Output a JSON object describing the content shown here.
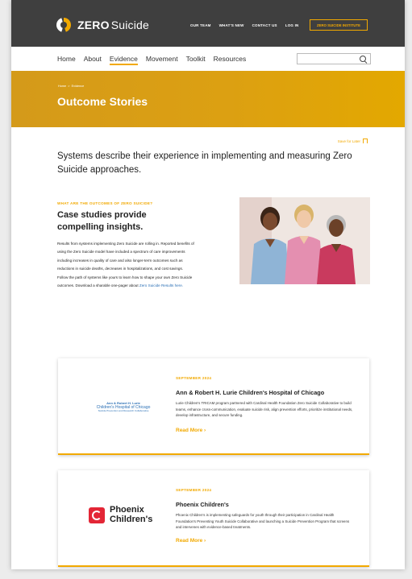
{
  "header": {
    "logo_bold": "ZERO",
    "logo_rest": "Suicide",
    "links": [
      "OUR TEAM",
      "WHAT'S NEW",
      "CONTACT US",
      "LOG IN"
    ],
    "institute_button": "ZERO SUICIDE INSTITUTE"
  },
  "nav": {
    "items": [
      "Home",
      "About",
      "Evidence",
      "Movement",
      "Toolkit",
      "Resources"
    ],
    "active": "Evidence",
    "search_placeholder": ""
  },
  "hero": {
    "breadcrumb": "Home  >  Evidence",
    "title": "Outcome Stories"
  },
  "save_label": "Save for Later",
  "intro": "Systems describe their experience in implementing and measuring Zero Suicide approaches.",
  "case_study": {
    "eyebrow": "WHAT ARE THE OUTCOMES OF ZERO SUICIDE?",
    "title": "Case studies provide compelling insights.",
    "body": "Results from systems implementing Zero Suicide are rolling in. Reported benefits of using the Zero Suicide model have included a spectrum of care improvements including increases in quality of care and also longer-term outcomes such as reductions in suicide deaths, decreases in hospitalizations, and cost savings. Follow the path of systems like yours to learn how to shape your own Zero Suicide outcomes. Download a sharable one-pager about",
    "link": "Zero Suicide Results here."
  },
  "cards": [
    {
      "date": "SEPTEMBER 2024",
      "title": "Ann & Robert H. Lurie Children's Hospital of Chicago",
      "text": "Lurie Children's TRICAM program partnered with Cardinal Health Foundation Zero Suicide Collaborative to build teams, enhance cross-communication, evaluate suicide risk, align prevention efforts, prioritize institutional needs, develop infrastructure, and secure funding.",
      "read_more": "Read More ›",
      "logo_line1": "Ann & Robert H. Lurie",
      "logo_line2": "Children's Hospital of Chicago",
      "logo_line3": "Suicide Prevention and Research Collaborative"
    },
    {
      "date": "SEPTEMBER 2024",
      "title": "Phoenix Children's",
      "text": "Phoenix Children's is implementing safeguards for youth through their participation in Cardinal Health Foundation's Preventing Youth Suicide Collaborative and launching a Suicide Prevention Program that screens and intervenes with evidence-based treatments.",
      "read_more": "Read More ›",
      "logo_line1": "Phoenix",
      "logo_line2": "Children's"
    }
  ]
}
